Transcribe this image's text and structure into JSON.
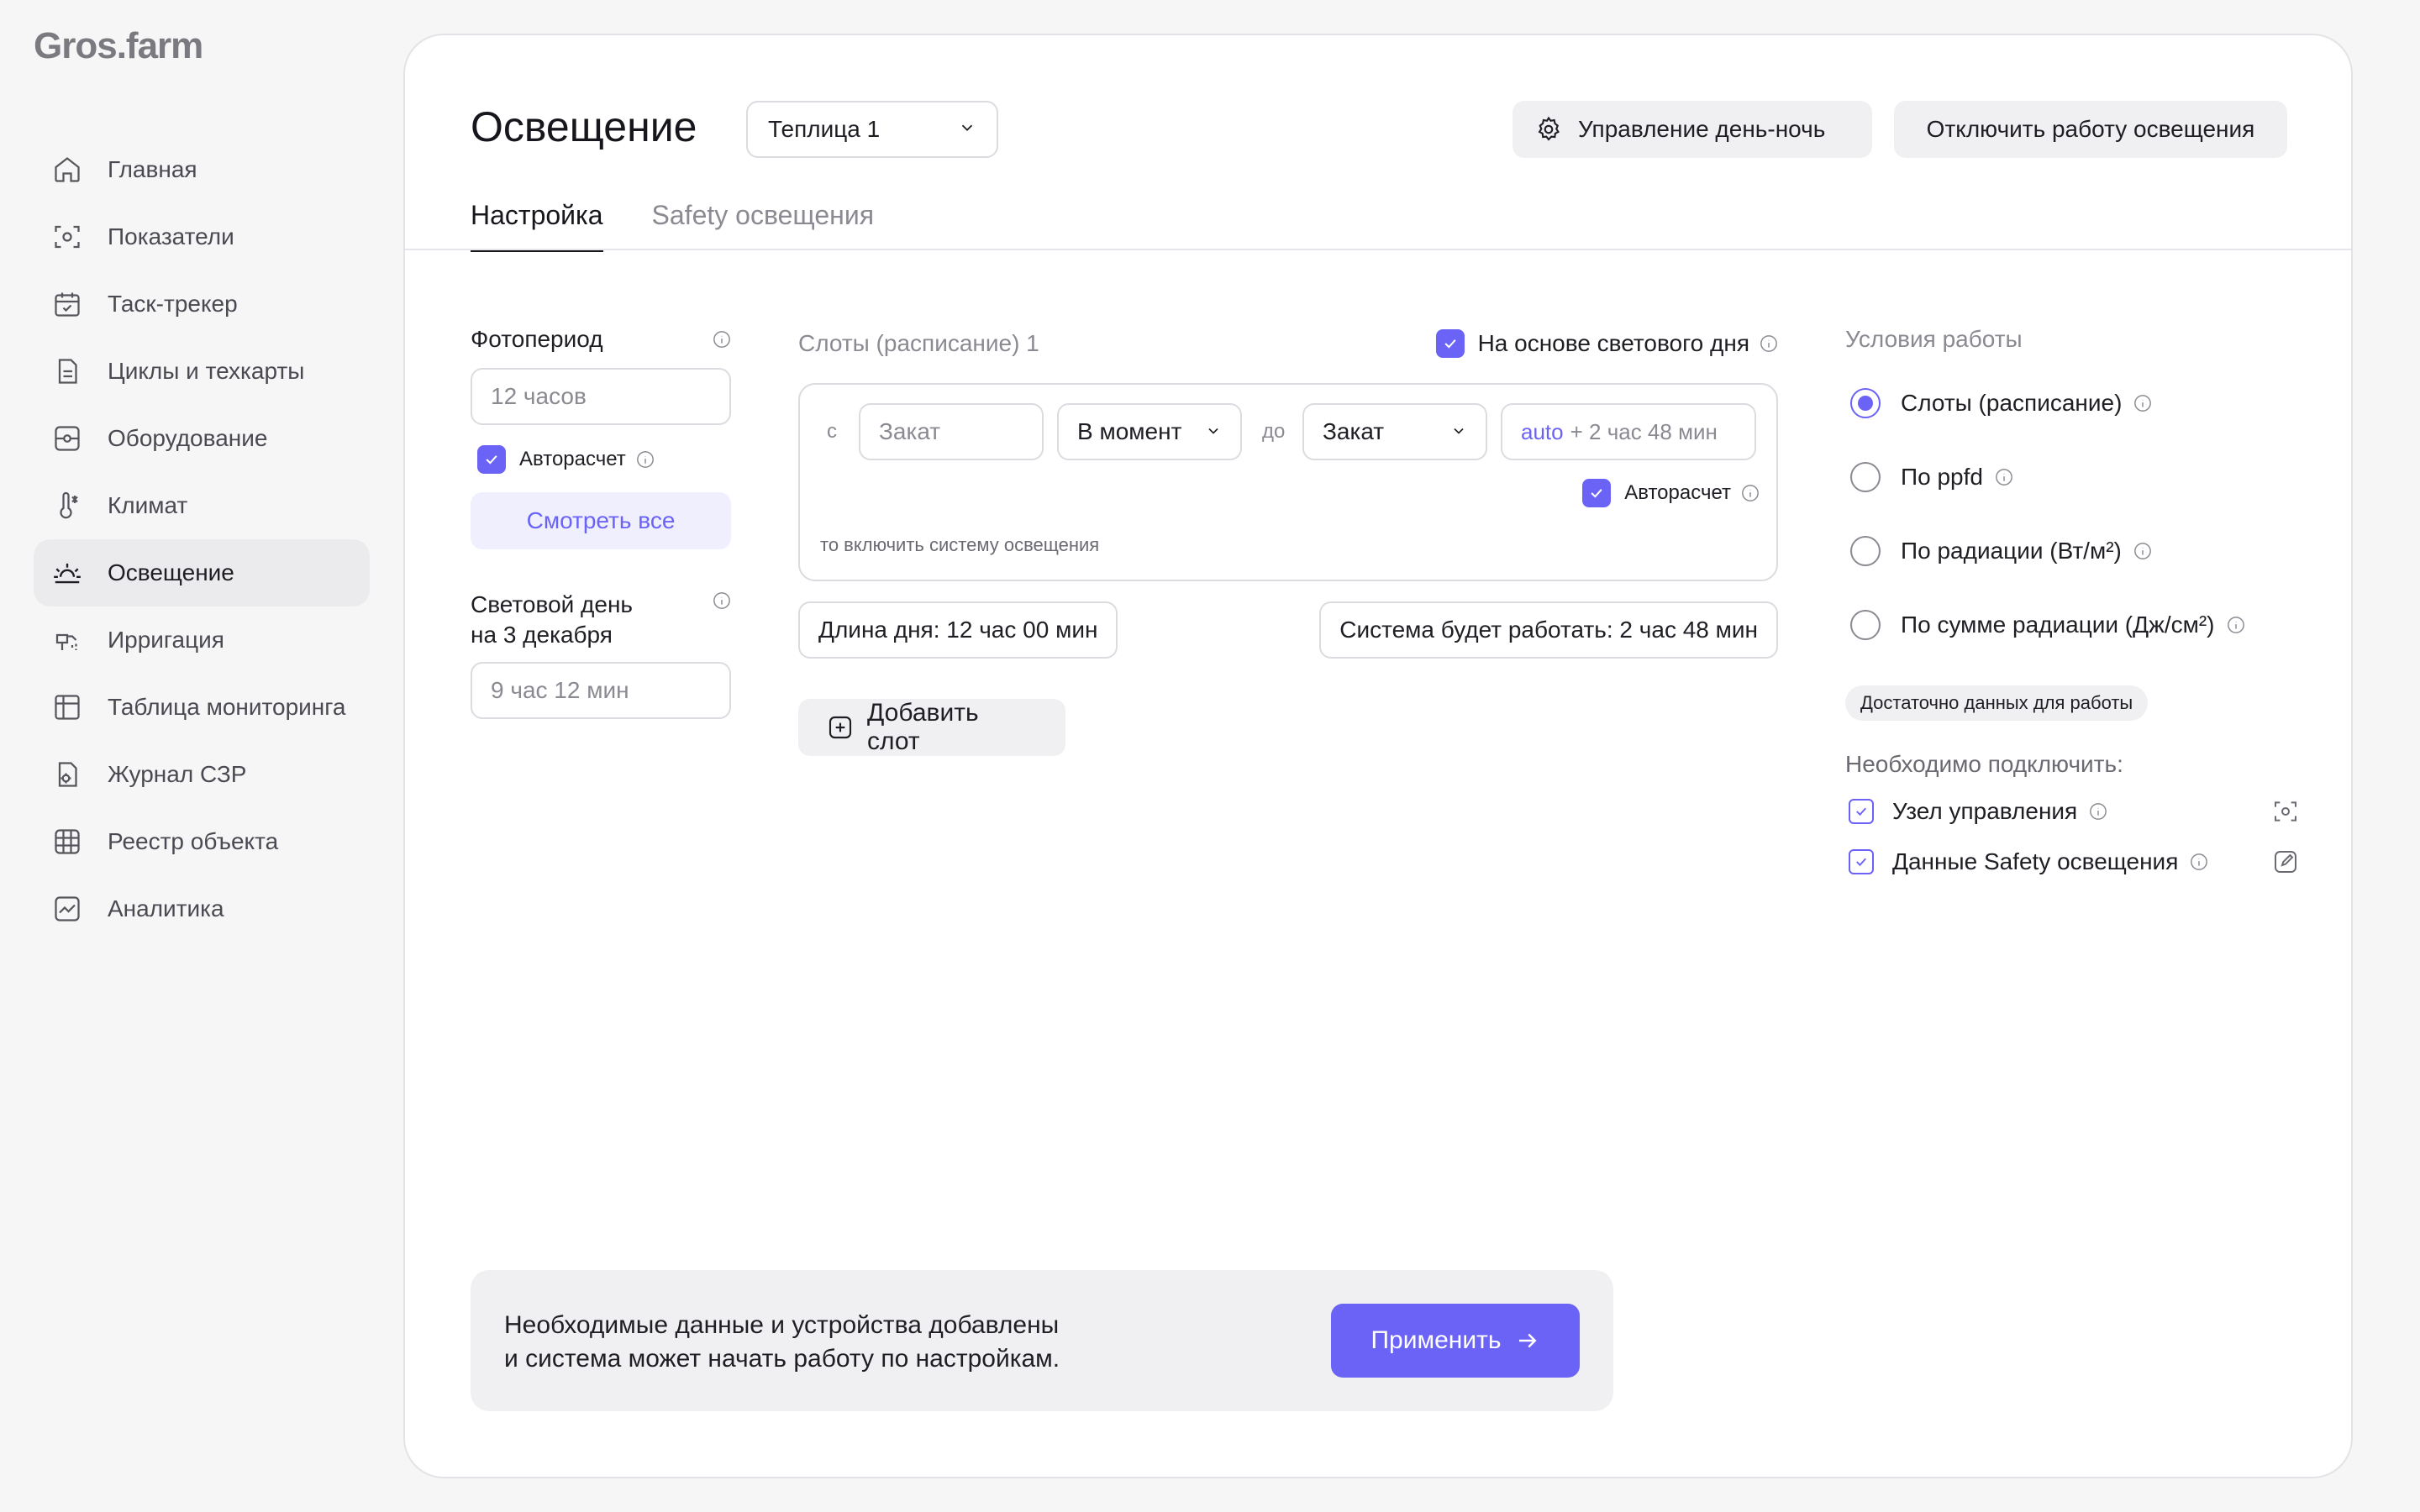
{
  "brand": {
    "logo": "Gros.farm"
  },
  "sidebar": {
    "items": [
      {
        "label": "Главная",
        "icon": "home-icon"
      },
      {
        "label": "Показатели",
        "icon": "indicators-icon"
      },
      {
        "label": "Таск-трекер",
        "icon": "calendar-icon"
      },
      {
        "label": "Циклы и техкарты",
        "icon": "document-icon"
      },
      {
        "label": "Оборудование",
        "icon": "equipment-icon"
      },
      {
        "label": "Климат",
        "icon": "thermometer-icon"
      },
      {
        "label": "Освещение",
        "icon": "sunrise-icon",
        "active": true
      },
      {
        "label": "Ирригация",
        "icon": "irrigation-icon"
      },
      {
        "label": "Таблица мониторинга",
        "icon": "table-icon"
      },
      {
        "label": "Журнал СЗР",
        "icon": "journal-icon"
      },
      {
        "label": "Реестр объекта",
        "icon": "grid-icon"
      },
      {
        "label": "Аналитика",
        "icon": "analytics-icon"
      }
    ]
  },
  "header": {
    "title": "Освещение",
    "greenhouse_select": "Теплица 1",
    "daynight_button": "Управление день-ночь",
    "disable_button": "Отключить работу освещения"
  },
  "tabs": [
    {
      "label": "Настройка",
      "active": true
    },
    {
      "label": "Safety освещения",
      "active": false
    }
  ],
  "left": {
    "photoperiod_label": "Фотопериод",
    "photoperiod_placeholder": "12 часов",
    "autocalc_label": "Авторасчет",
    "view_all_button": "Смотреть все",
    "daylight_label_line1": "Световой день",
    "daylight_label_line2": "на 3 декабря",
    "daylight_value": "9 час 12 мин"
  },
  "slots": {
    "title": "Слоты (расписание) 1",
    "daylight_based_label": "На основе светового дня",
    "from_label": "с",
    "from_placeholder": "Закат",
    "moment_select": "В момент",
    "to_label": "до",
    "to_select": "Закат",
    "auto_prefix": "auto",
    "auto_value": "+ 2 час 48 мин",
    "autocalc_label": "Авторасчет",
    "hint": "то включить систему освещения",
    "day_length": "Длина дня: 12 час 00 мин",
    "system_work": "Система будет работать: 2 час 48 мин",
    "add_slot_button": "Добавить слот"
  },
  "conditions": {
    "title": "Условия работы",
    "options": [
      {
        "label": "Слоты (расписание)",
        "selected": true
      },
      {
        "label": "По ppfd",
        "selected": false
      },
      {
        "label": "По радиации (Вт/м²)",
        "selected": false
      },
      {
        "label": "По сумме радиации (Дж/см²)",
        "selected": false
      }
    ],
    "badge": "Достаточно данных для работы",
    "required_label": "Необходимо подключить:",
    "required": [
      {
        "label": "Узел управления",
        "action_icon": "scan-icon"
      },
      {
        "label": "Данные Safety освещения",
        "action_icon": "edit-icon"
      }
    ]
  },
  "footer": {
    "message_line1": "Необходимые данные и устройства добавлены",
    "message_line2": "и система может начать работу по настройкам.",
    "apply_button": "Применить"
  },
  "colors": {
    "accent": "#6a63f6",
    "background": "#f6f6f6",
    "panel": "#ffffff",
    "muted_text": "#8a8a92"
  }
}
